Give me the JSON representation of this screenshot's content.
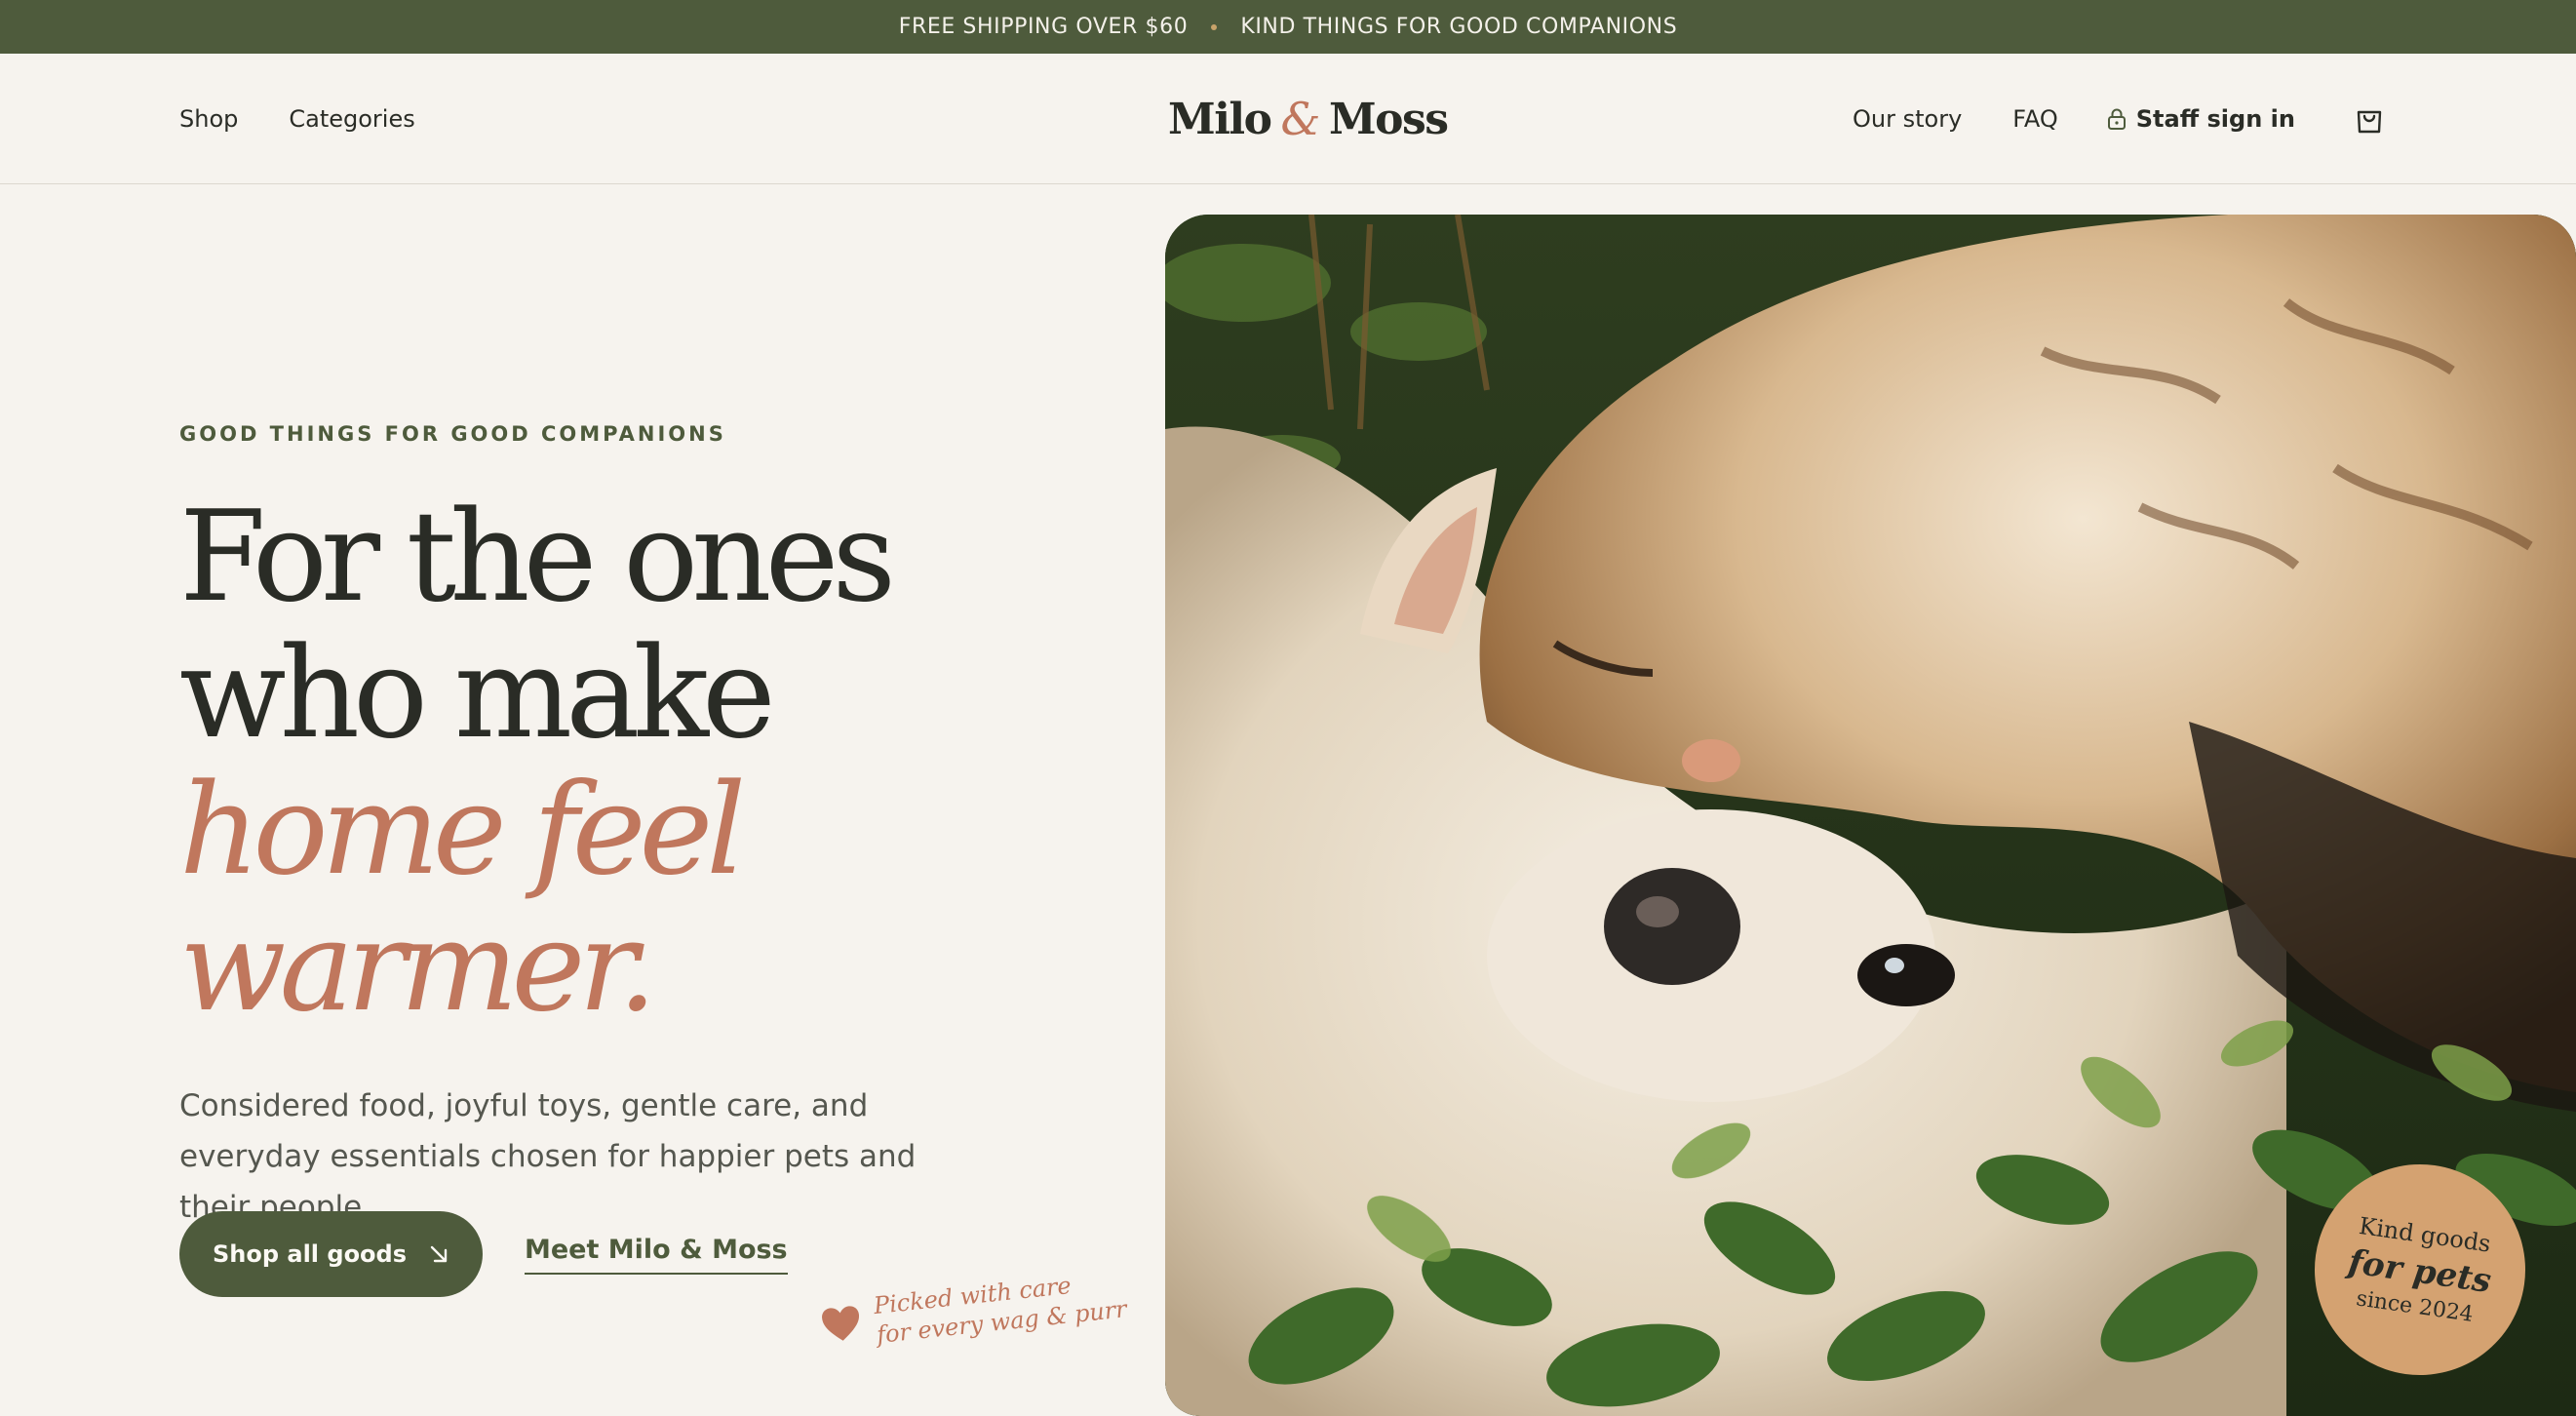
{
  "announcement": {
    "left": "FREE SHIPPING OVER $60",
    "right": "KIND THINGS FOR GOOD COMPANIONS"
  },
  "header": {
    "nav_left": [
      "Shop",
      "Categories"
    ],
    "logo": {
      "first": "Milo",
      "amp": "&",
      "last": "Moss"
    },
    "nav_right": {
      "story": "Our story",
      "faq": "FAQ",
      "staff": "Staff sign in"
    },
    "icons": {
      "staff": "lock-icon",
      "cart": "shopping-bag-icon"
    }
  },
  "hero": {
    "eyebrow": "GOOD THINGS FOR GOOD COMPANIONS",
    "headline": {
      "line1": "For the ones",
      "line2": "who make",
      "line3": "home feel",
      "line4": "warmer."
    },
    "lede": "Considered food, joyful toys, gentle care, and everyday essentials chosen for happier pets and their people.",
    "primary_cta": "Shop all goods",
    "secondary_cta": "Meet Milo & Moss",
    "picked": {
      "line1": "Picked with care",
      "line2": "for every wag & purr"
    }
  },
  "badge": {
    "line1": "Kind goods",
    "line2": "for pets",
    "line3": "since 2024"
  },
  "colors": {
    "brand_green": "#4e5b3c",
    "terracotta": "#c0775d",
    "cream": "#f6f3ee",
    "badge_tan": "#d4a271"
  }
}
